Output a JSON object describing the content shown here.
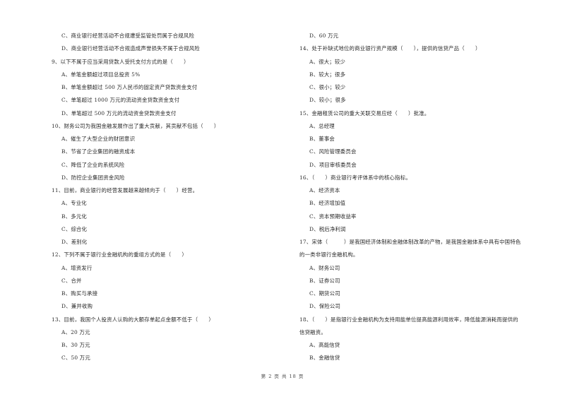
{
  "left_column": {
    "q8_tail": {
      "options": [
        "C、商业银行经营活动不合规遭受监管处罚属于合规风险",
        "D、商业银行经营活动不合规造成声誉损失不属于合规风险"
      ]
    },
    "questions": [
      {
        "stem": "9、以下不属于应当采用贷款人受托支付方式的是（　　）",
        "options": [
          "A、单笔金额超过项目总投资 5%",
          "B、单笔金额超过 500 万人民币的固定资产贷款资金支付",
          "C、单笔超过 1000 万元的流动资金贷款资金支付",
          "D、单笔超过 500 万元的流动资金贷款资金支付"
        ]
      },
      {
        "stem": "10、财务公司为我国金融发展作出了重大贡献，其贡献不包括（　　）",
        "options": [
          "A、催生了大型企业的财团意识",
          "B、节省了企业集团的融资成本",
          "C、降低了企业的系统风险",
          "D、防控企业集团资金风险"
        ]
      },
      {
        "stem": "11、目前，商业银行的经营发展越来越倾向于（　　）经营。",
        "options": [
          "A、专业化",
          "B、多元化",
          "C、综合化",
          "D、差别化"
        ]
      },
      {
        "stem": "12、下列不属于银行业金融机构的重组方式的是（　　）",
        "options": [
          "A、增资发行",
          "C、合并",
          "B、购买与承接",
          "D、兼并收购"
        ]
      },
      {
        "stem": "13、目前，我国个人投资人认购的大额存单起点金额不低于（　　）",
        "options": [
          "A、20 万元",
          "B、30 万元",
          "C、50 万元"
        ]
      }
    ]
  },
  "right_column": {
    "q13_tail": {
      "options": [
        "D、60 万元"
      ]
    },
    "questions": [
      {
        "stem": "14、处于补缺式地位的商业银行资产规模（　　），提供的信贷产品（　　）",
        "options": [
          "A、很大；较少",
          "B、较大；很多",
          "C、很小；较少",
          "D、较小；很多"
        ]
      },
      {
        "stem": "15、金融租赁公司的重大关联交易应经（　　）批准。",
        "options": [
          "A、总经理",
          "B、董事会",
          "C、风险管理委员会",
          "D、项目审核委员会"
        ]
      },
      {
        "stem": "16、（　　）商业银行考评体系中的核心指标。",
        "options": [
          "A、经济资本",
          "B、经济增加值",
          "C、资本预期收益率",
          "D、税后净利润"
        ]
      },
      {
        "stem": "17、宋体（　　　）是我国经济体制和金融体制改革的产物，是我国金融体系中具有中国特色",
        "stem_cont": "的一类非银行金融机构。",
        "options": [
          "A、财务公司",
          "B、证券公司",
          "C、期货公司",
          "D、保险公司"
        ]
      },
      {
        "stem": "18、（　　）是指银行业金融机构为支持用能单位提高能源利用效率，降低能源消耗而提供的",
        "stem_cont": "信贷融资。",
        "options": [
          "A、高能信贷",
          "B、金融信贷"
        ]
      }
    ]
  },
  "footer": {
    "page_label": "第 2 页 共 18 页"
  }
}
